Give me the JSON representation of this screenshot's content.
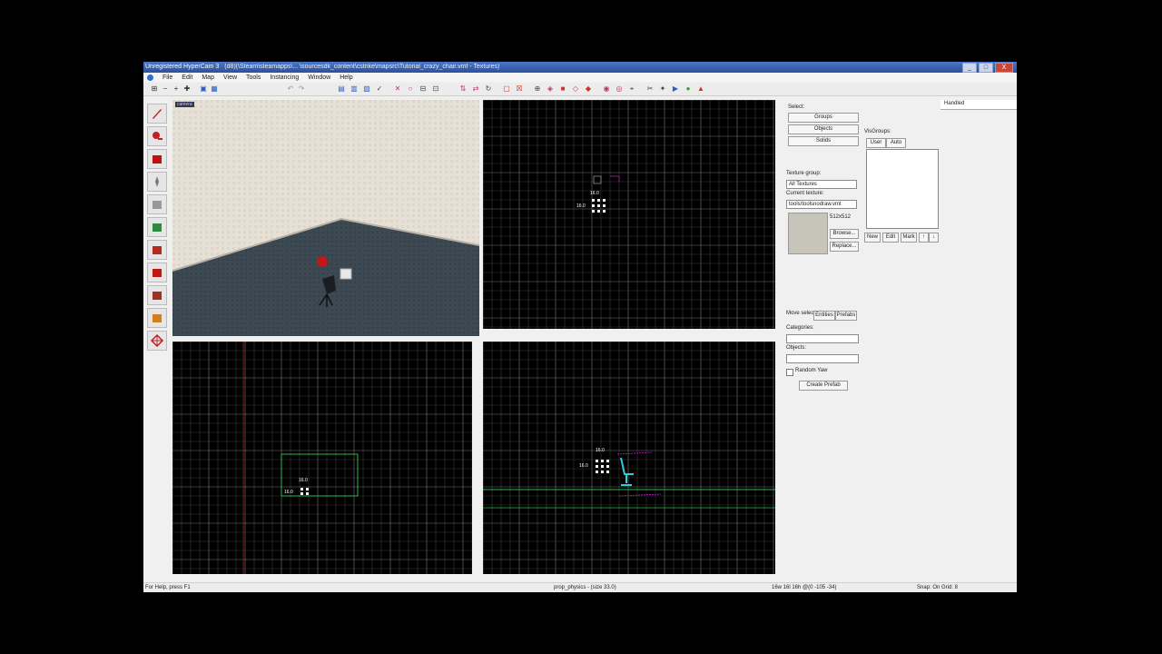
{
  "window": {
    "title": "Unregistered HyperCam 3",
    "document": "(d8)(\\Steam\\steamapps\\... \\sourcesdk_content\\cstrike\\mapsrc\\Tutorial_crazy_chair.vmf - Textures)",
    "buttons": [
      "_",
      "□",
      "X"
    ]
  },
  "menu": [
    "File",
    "Edit",
    "Map",
    "View",
    "Tools",
    "Instancing",
    "Window",
    "Help"
  ],
  "viewports": {
    "camera_label": "camera",
    "top_scale_1": "16.0",
    "top_scale_2": "16.0",
    "front_scale_1": "16.0",
    "front_scale_2": "16.0",
    "side_scale_1": "16.0",
    "side_scale_2": "16.0"
  },
  "select_panel": {
    "heading": "Select:",
    "buttons": [
      "Groups",
      "Objects",
      "Solids"
    ]
  },
  "texture_panel": {
    "group_label": "Texture group:",
    "group_value": "All Textures",
    "current_label": "Current texture:",
    "current_value": "tools/toolsnodraw.vmt",
    "size": "512x512",
    "browse": "Browse...",
    "replace": "Replace..."
  },
  "visgroups_panel": {
    "heading": "VisGroups:",
    "tabs": [
      "User",
      "Auto"
    ],
    "buttons": [
      "New",
      "Edit",
      "Mark"
    ]
  },
  "tab_header": "Handled",
  "entity_panel": {
    "move_label": "Move selected",
    "tabs": [
      "Entities",
      "Prefabs"
    ],
    "categories_label": "Categories:",
    "objects_label": "Objects:",
    "random_yaw": "Random Yaw",
    "create_prefab": "Create Prefab"
  },
  "statusbar": {
    "help": "For Help, press F1",
    "selection": "prop_physics - (size 33.0)",
    "coords": "16w 16l 16h @(0 -105 -34)",
    "snap": "Snap: On Grid: 8"
  }
}
